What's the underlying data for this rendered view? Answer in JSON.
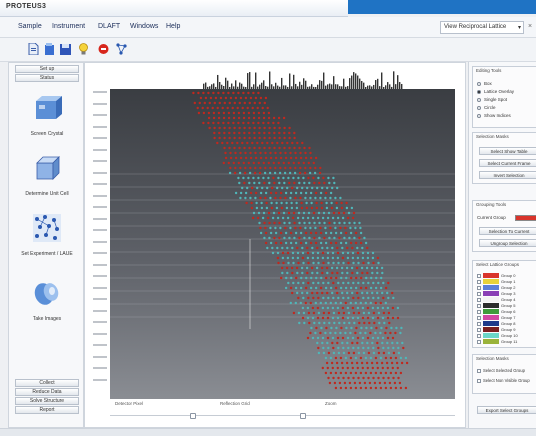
{
  "window": {
    "title": "PROTEUS3",
    "accent_color": "#1f73c4"
  },
  "menu": {
    "items": [
      "Sample",
      "Instrument",
      "DLAFT",
      "Windows",
      "Help"
    ],
    "view_select": "View Reciprocal Lattice"
  },
  "toolbar": {
    "icons": [
      "new-file-icon",
      "open-file-icon",
      "save-icon",
      "lightbulb-icon",
      "stop-icon",
      "network-icon"
    ]
  },
  "left_panel": {
    "top_buttons": [
      "Set up",
      "Status"
    ],
    "workflow": [
      {
        "label": "Screen Crystal",
        "icon": "crystal-icon"
      },
      {
        "label": "Determine Unit Cell",
        "icon": "unit-cell-icon"
      },
      {
        "label": "Set Experiment / LAUE",
        "icon": "lattice-icon"
      },
      {
        "label": "Take Images",
        "icon": "images-icon"
      }
    ],
    "bottom_buttons": [
      "Collect",
      "Reduce Data",
      "Solve Structure",
      "Report"
    ]
  },
  "viewer": {
    "bottom_labels": [
      "Detector Pixel",
      "Reflection Grid",
      "Zoom"
    ],
    "spot_colors": {
      "red": "#c0281e",
      "cyan": "#4fb6b9"
    }
  },
  "right_panel": {
    "editing_tools": {
      "title": "Editing Tools",
      "options": [
        "Box",
        "Lattice Overlay",
        "Single Spot",
        "Circle",
        "Show Indices"
      ],
      "selected": 1
    },
    "selection_masks": {
      "title": "Selection Masks",
      "buttons": [
        "Select Show Table",
        "Select Current Frame",
        "Invert Selection"
      ]
    },
    "grouping_tools": {
      "title": "Grouping Tools",
      "current_group_label": "Current Group",
      "current_group_color": "#d9342b",
      "buttons": [
        "Selection To Current",
        "Ungroup Selection"
      ]
    },
    "select_lattice_groups": {
      "title": "Select Lattice Groups",
      "groups": [
        {
          "name": "Group 0",
          "color": "#d9342b"
        },
        {
          "name": "Group 1",
          "color": "#e8d23a"
        },
        {
          "name": "Group 2",
          "color": "#5c7fd8"
        },
        {
          "name": "Group 3",
          "color": "#8a3fb6"
        },
        {
          "name": "Group 4",
          "color": "#f3f3f3"
        },
        {
          "name": "Group 5",
          "color": "#2c2c2c"
        },
        {
          "name": "Group 6",
          "color": "#3f9b3b"
        },
        {
          "name": "Group 7",
          "color": "#d247a3"
        },
        {
          "name": "Group 8",
          "color": "#1e3a8a"
        },
        {
          "name": "Group 9",
          "color": "#7a1f1f"
        },
        {
          "name": "Group 10",
          "color": "#6bd6c8"
        },
        {
          "name": "Group 11",
          "color": "#9ab33a"
        }
      ]
    },
    "selection_masks2": {
      "title": "Selection Masks",
      "checks": [
        "Select Selected Group",
        "Select Non Visible Group"
      ]
    },
    "bottom_button": "Export Select Groups"
  }
}
